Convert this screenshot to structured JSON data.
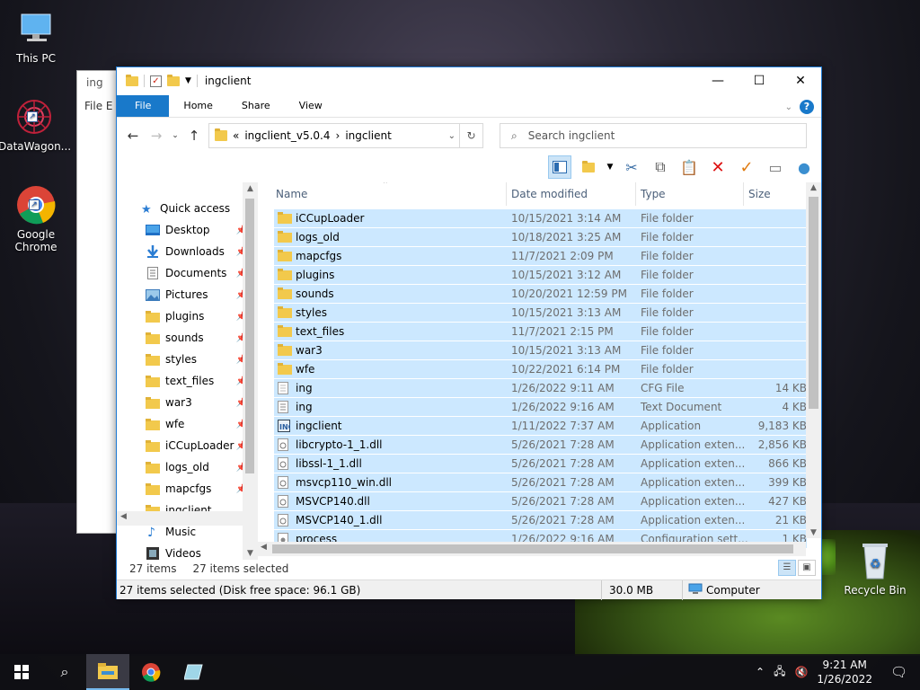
{
  "desktop": {
    "icons": [
      {
        "label": "This PC"
      },
      {
        "label": "DataWagon..."
      },
      {
        "label": "Google Chrome"
      },
      {
        "label": "Recycle Bin"
      }
    ]
  },
  "background_window": {
    "title": "ing",
    "menu": "File  E"
  },
  "window": {
    "title": "ingclient",
    "controls": {
      "minimize": "—",
      "maximize": "☐",
      "close": "✕"
    },
    "ribbon_tabs": [
      "File",
      "Home",
      "Share",
      "View"
    ],
    "help": "?",
    "address": {
      "prefix": "«",
      "crumbs": [
        "ingclient_v5.0.4",
        "ingclient"
      ],
      "separator": "›"
    },
    "search_placeholder": "Search ingclient",
    "columns": {
      "name": "Name",
      "date": "Date modified",
      "type": "Type",
      "size": "Size"
    },
    "nav": [
      {
        "label": "Quick access",
        "icon": "star-icon",
        "pinned": false
      },
      {
        "label": "Desktop",
        "icon": "desktop-icon",
        "pinned": true
      },
      {
        "label": "Downloads",
        "icon": "download-icon",
        "pinned": true
      },
      {
        "label": "Documents",
        "icon": "document-icon",
        "pinned": true
      },
      {
        "label": "Pictures",
        "icon": "picture-icon",
        "pinned": true
      },
      {
        "label": "plugins",
        "icon": "folder-icon",
        "pinned": true
      },
      {
        "label": "sounds",
        "icon": "folder-icon",
        "pinned": true
      },
      {
        "label": "styles",
        "icon": "folder-icon",
        "pinned": true
      },
      {
        "label": "text_files",
        "icon": "folder-icon",
        "pinned": true
      },
      {
        "label": "war3",
        "icon": "folder-icon",
        "pinned": true
      },
      {
        "label": "wfe",
        "icon": "folder-icon",
        "pinned": true
      },
      {
        "label": "iCCupLoader",
        "icon": "folder-icon",
        "pinned": true
      },
      {
        "label": "logs_old",
        "icon": "folder-icon",
        "pinned": true
      },
      {
        "label": "mapcfgs",
        "icon": "folder-icon",
        "pinned": true
      },
      {
        "label": "ingclient",
        "icon": "folder-icon",
        "pinned": false
      },
      {
        "label": "Music",
        "icon": "music-icon",
        "pinned": false
      },
      {
        "label": "Videos",
        "icon": "video-icon",
        "pinned": false
      }
    ],
    "files": [
      {
        "name": "iCCupLoader",
        "date": "10/15/2021 3:14 AM",
        "type": "File folder",
        "size": "",
        "icon": "folder-icon"
      },
      {
        "name": "logs_old",
        "date": "10/18/2021 3:25 AM",
        "type": "File folder",
        "size": "",
        "icon": "folder-icon"
      },
      {
        "name": "mapcfgs",
        "date": "11/7/2021 2:09 PM",
        "type": "File folder",
        "size": "",
        "icon": "folder-icon"
      },
      {
        "name": "plugins",
        "date": "10/15/2021 3:12 AM",
        "type": "File folder",
        "size": "",
        "icon": "folder-icon"
      },
      {
        "name": "sounds",
        "date": "10/20/2021 12:59 PM",
        "type": "File folder",
        "size": "",
        "icon": "folder-icon"
      },
      {
        "name": "styles",
        "date": "10/15/2021 3:13 AM",
        "type": "File folder",
        "size": "",
        "icon": "folder-icon"
      },
      {
        "name": "text_files",
        "date": "11/7/2021 2:15 PM",
        "type": "File folder",
        "size": "",
        "icon": "folder-icon"
      },
      {
        "name": "war3",
        "date": "10/15/2021 3:13 AM",
        "type": "File folder",
        "size": "",
        "icon": "folder-icon"
      },
      {
        "name": "wfe",
        "date": "10/22/2021 6:14 PM",
        "type": "File folder",
        "size": "",
        "icon": "folder-icon"
      },
      {
        "name": "ing",
        "date": "1/26/2022 9:11 AM",
        "type": "CFG File",
        "size": "14 KB",
        "icon": "cfg-file-icon"
      },
      {
        "name": "ing",
        "date": "1/26/2022 9:16 AM",
        "type": "Text Document",
        "size": "4 KB",
        "icon": "text-file-icon"
      },
      {
        "name": "ingclient",
        "date": "1/11/2022 7:37 AM",
        "type": "Application",
        "size": "9,183 KB",
        "icon": "application-icon"
      },
      {
        "name": "libcrypto-1_1.dll",
        "date": "5/26/2021 7:28 AM",
        "type": "Application exten...",
        "size": "2,856 KB",
        "icon": "dll-file-icon"
      },
      {
        "name": "libssl-1_1.dll",
        "date": "5/26/2021 7:28 AM",
        "type": "Application exten...",
        "size": "866 KB",
        "icon": "dll-file-icon"
      },
      {
        "name": "msvcp110_win.dll",
        "date": "5/26/2021 7:28 AM",
        "type": "Application exten...",
        "size": "399 KB",
        "icon": "dll-file-icon"
      },
      {
        "name": "MSVCP140.dll",
        "date": "5/26/2021 7:28 AM",
        "type": "Application exten...",
        "size": "427 KB",
        "icon": "dll-file-icon"
      },
      {
        "name": "MSVCP140_1.dll",
        "date": "5/26/2021 7:28 AM",
        "type": "Application exten...",
        "size": "21 KB",
        "icon": "dll-file-icon"
      },
      {
        "name": "process",
        "date": "1/26/2022 9:16 AM",
        "type": "Configuration sett...",
        "size": "1 KB",
        "icon": "config-file-icon"
      }
    ],
    "status": {
      "count": "27 items",
      "selected": "27 items selected"
    },
    "bottom": {
      "text": "27 items selected (Disk free space: 96.1 GB)",
      "size": "30.0 MB",
      "location": "Computer"
    }
  },
  "taskbar": {
    "time": "9:21 AM",
    "date": "1/26/2022"
  },
  "colors": {
    "accent": "#1979ca",
    "selection": "#cce8ff",
    "folder": "#f2c94c"
  }
}
